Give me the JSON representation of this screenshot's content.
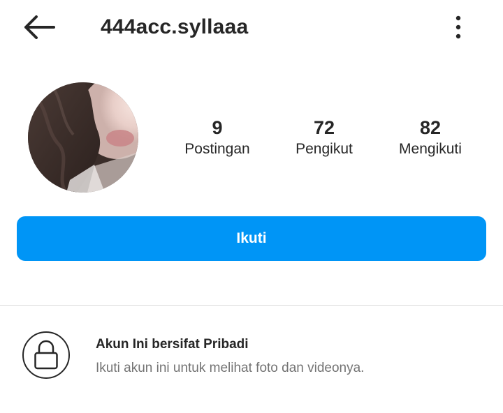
{
  "header": {
    "username": "444acc.syllaaa",
    "back_icon": "arrow-left-icon",
    "more_icon": "more-vertical-icon"
  },
  "stats": [
    {
      "value": "9",
      "label": "Postingan"
    },
    {
      "value": "72",
      "label": "Pengikut"
    },
    {
      "value": "82",
      "label": "Mengikuti"
    }
  ],
  "follow_button": {
    "label": "Ikuti",
    "color": "#0095f6"
  },
  "private_notice": {
    "icon": "lock-icon",
    "title": "Akun Ini bersifat Pribadi",
    "description": "Ikuti akun ini untuk melihat foto dan videonya."
  }
}
